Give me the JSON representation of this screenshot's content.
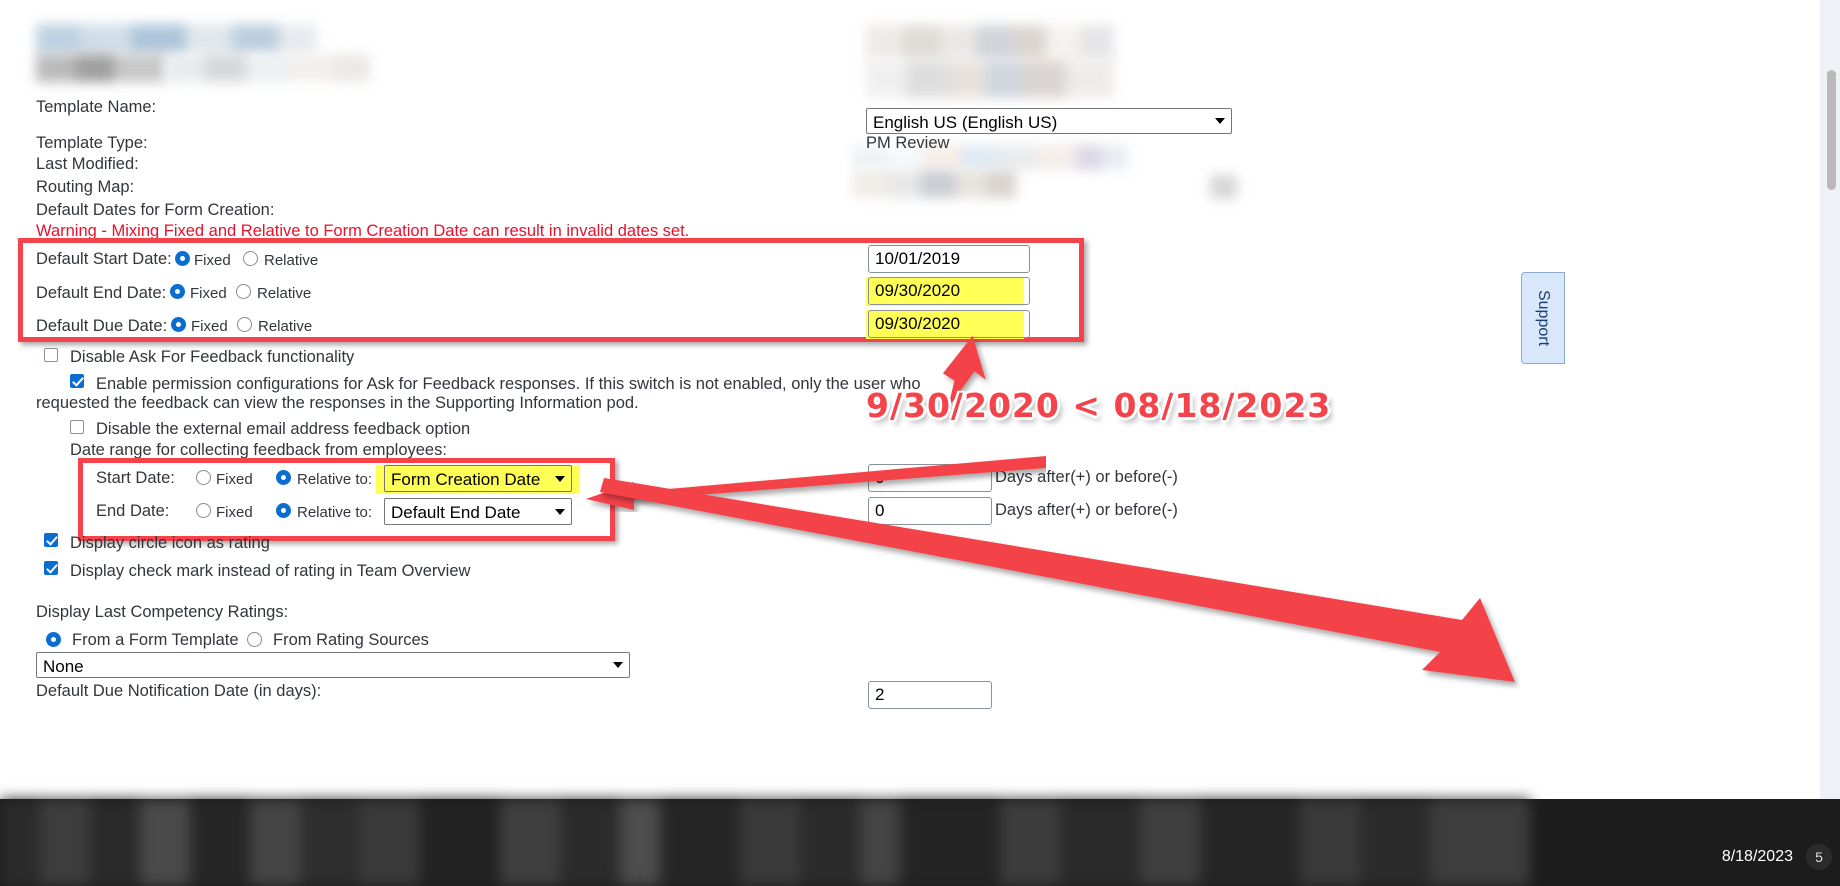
{
  "form": {
    "fields": [
      {
        "label": "Template Name:"
      },
      {
        "label": "Template Type:"
      },
      {
        "label": "Last Modified:"
      },
      {
        "label": "Routing Map:"
      },
      {
        "label": "Default Dates for Form Creation:"
      }
    ],
    "warning": "Warning - Mixing Fixed and Relative to Form Creation Date can result in invalid dates set.",
    "language_select": "English US (English US)",
    "pm_review_label": "PM Review",
    "default_dates": {
      "rows": [
        {
          "label": "Default Start Date:",
          "fixed_label": "Fixed",
          "relative_label": "Relative",
          "selected": "Fixed",
          "value": "10/01/2019",
          "highlighted": false
        },
        {
          "label": "Default End Date:",
          "fixed_label": "Fixed",
          "relative_label": "Relative",
          "selected": "Fixed",
          "value": "09/30/2020",
          "highlighted": true
        },
        {
          "label": "Default Due Date:",
          "fixed_label": "Fixed",
          "relative_label": "Relative",
          "selected": "Fixed",
          "value": "09/30/2020",
          "highlighted": true
        }
      ]
    },
    "checkboxes": {
      "disable_ask_for_feedback": {
        "label": "Disable Ask For Feedback functionality",
        "checked": false
      },
      "enable_permission_configs": {
        "label_line1": "Enable permission configurations for Ask for Feedback responses. If this switch is not enabled, only the user who",
        "label_line2": "requested the feedback can view the responses in the Supporting Information pod.",
        "checked": true
      },
      "disable_external_email": {
        "label": "Disable the external email address feedback option",
        "checked": false
      },
      "display_circle_icon": {
        "label": "Display circle icon as rating",
        "checked": true
      },
      "display_check_mark": {
        "label": "Display check mark instead of rating in Team Overview",
        "checked": true
      }
    },
    "feedback_range": {
      "section_label": "Date range for collecting feedback from employees:",
      "rows": [
        {
          "label": "Start Date:",
          "fixed_label": "Fixed",
          "relative_label": "Relative to:",
          "selected": "Relative",
          "relative_value": "Form Creation Date",
          "days_value": "0",
          "days_label": "Days after(+) or before(-)",
          "highlighted": true
        },
        {
          "label": "End Date:",
          "fixed_label": "Fixed",
          "relative_label": "Relative to:",
          "selected": "Relative",
          "relative_value": "Default End Date",
          "days_value": "0",
          "days_label": "Days after(+) or before(-)",
          "highlighted": false
        }
      ]
    },
    "competency": {
      "label": "Display Last Competency Ratings:",
      "option_form_template": "From a Form Template",
      "option_rating_sources": "From Rating Sources",
      "selected": "From a Form Template",
      "template_select": "None"
    },
    "due_notification_label": "Default Due Notification Date (in days):",
    "due_notification_value": "2"
  },
  "annotation": {
    "comparison_text": "9/30/2020  <  08/18/2023",
    "accent_color": "#f4434a"
  },
  "chrome": {
    "support_tab": "Support",
    "status_date": "8/18/2023",
    "badge": "5"
  }
}
